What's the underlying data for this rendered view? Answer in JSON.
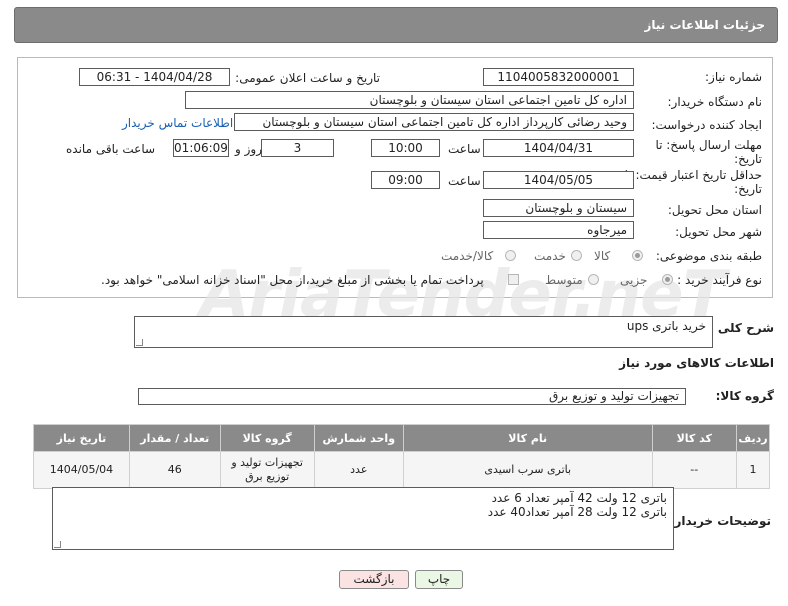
{
  "header": {
    "title": "جزئیات اطلاعات نیاز"
  },
  "fields": {
    "need_number_label": "شماره نیاز:",
    "need_number": "1104005832000001",
    "announce_label": "تاریخ و ساعت اعلان عمومی:",
    "announce_value": "1404/04/28 - 06:31",
    "buyer_org_label": "نام دستگاه خریدار:",
    "buyer_org": "اداره کل تامین اجتماعی استان سیستان و بلوچستان",
    "requester_label": "ایجاد کننده درخواست:",
    "requester": "وحید رضائی کارپرداز اداره کل تامین اجتماعی استان سیستان و بلوچستان",
    "contact_link": "اطلاعات تماس خریدار",
    "deadline_label": "مهلت ارسال پاسخ: تا تاریخ:",
    "deadline_date": "1404/04/31",
    "time_label": "ساعت",
    "deadline_time": "10:00",
    "days_value": "3",
    "days_label": "روز و",
    "remaining_value": "01:06:09",
    "remaining_label": "ساعت باقی مانده",
    "validity_label": "حداقل تاریخ اعتبار قیمت: تا تاریخ:",
    "validity_date": "1404/05/05",
    "validity_time": "09:00",
    "province_label": "استان محل تحویل:",
    "province": "سیستان و بلوچستان",
    "city_label": "شهر محل تحویل:",
    "city": "میرجاوه",
    "category_label": "طبقه بندی موضوعی:",
    "category_options": [
      "کالا",
      "خدمت",
      "کالا/خدمت"
    ],
    "process_label": "نوع فرآیند خرید :",
    "process_options": [
      "جزیی",
      "متوسط"
    ],
    "process_note": "پرداخت تمام یا بخشی از مبلغ خرید،از محل \"اسناد خزانه اسلامی\" خواهد بود."
  },
  "summary": {
    "label": "شرح کلی نیاز:",
    "value": "خرید باتری ups"
  },
  "goods_section_title": "اطلاعات کالاهای مورد نیاز",
  "goods_group": {
    "label": "گروه کالا:",
    "value": "تجهیزات تولید و توزیع برق"
  },
  "table": {
    "headers": [
      "ردیف",
      "کد کالا",
      "نام کالا",
      "واحد شمارش",
      "گروه کالا",
      "تعداد / مقدار",
      "تاریخ نیاز"
    ],
    "rows": [
      [
        "1",
        "--",
        "باتری سرب اسیدی",
        "عدد",
        "تجهیزات تولید و توزیع برق",
        "46",
        "1404/05/04"
      ]
    ]
  },
  "buyer_notes": {
    "label": "توضیحات خریدار:",
    "line1": "باتری 12 ولت  42 آمپر تعداد 6 عدد",
    "line2": "باتری 12 ولت  28 آمپر تعداد40 عدد"
  },
  "buttons": {
    "print": "چاپ",
    "back": "بازگشت"
  },
  "watermark": "AriaTender.neT",
  "colors": {
    "header_bg": "#8a8a8a",
    "link": "#1a5fb4",
    "back_button_bg": "#fbe3e3",
    "print_button_bg": "#e9f7e4"
  }
}
